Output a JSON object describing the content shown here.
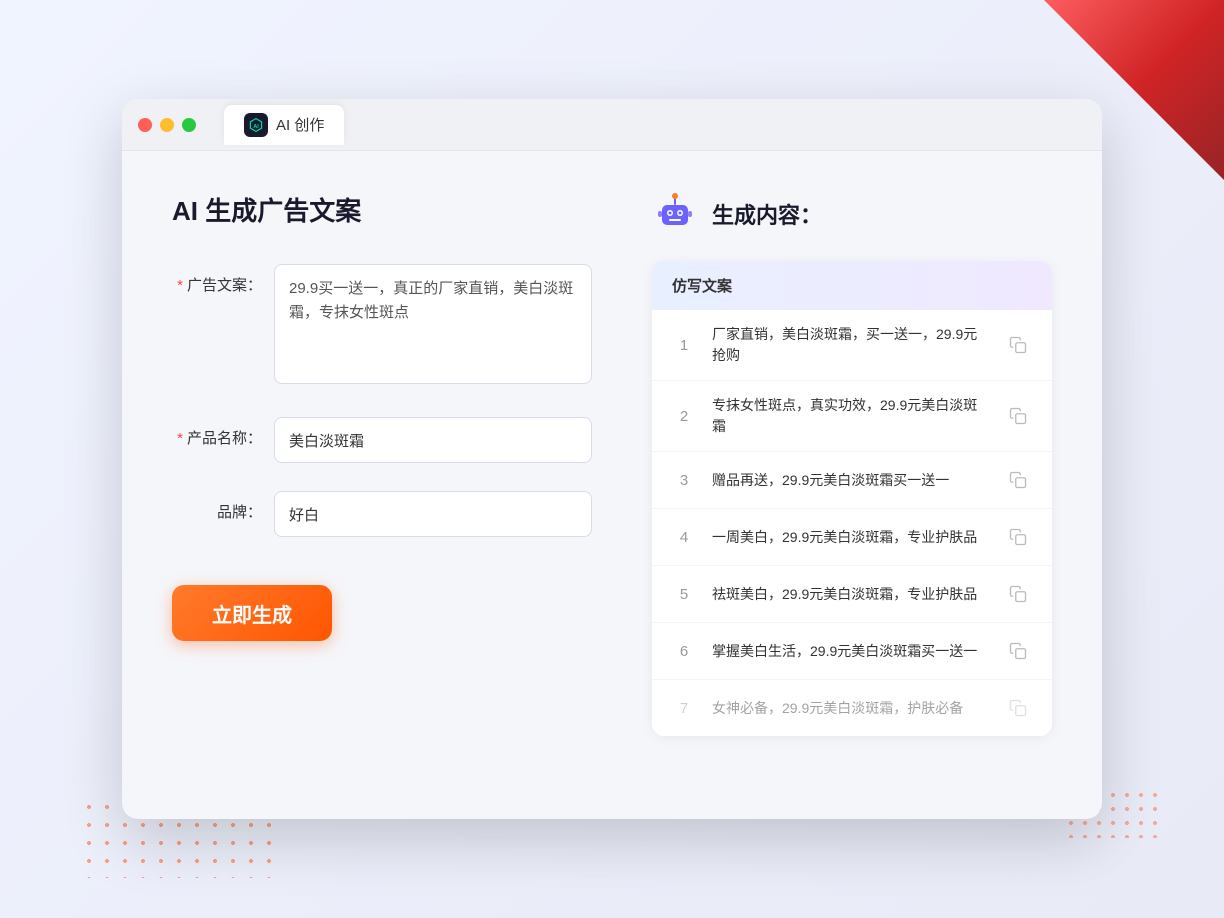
{
  "window": {
    "tab_label": "AI 创作"
  },
  "page": {
    "title": "AI 生成广告文案",
    "generate_button_label": "立即生成"
  },
  "form": {
    "ad_copy_label": "广告文案：",
    "ad_copy_required": "*",
    "ad_copy_value": "29.9买一送一，真正的厂家直销，美白淡斑霜，专抹女性斑点",
    "product_name_label": "产品名称：",
    "product_name_required": "*",
    "product_name_value": "美白淡斑霜",
    "brand_label": "品牌：",
    "brand_value": "好白"
  },
  "results": {
    "header_label": "仿写文案",
    "right_title": "生成内容：",
    "items": [
      {
        "num": "1",
        "text": "厂家直销，美白淡斑霜，买一送一，29.9元抢购",
        "dimmed": false
      },
      {
        "num": "2",
        "text": "专抹女性斑点，真实功效，29.9元美白淡斑霜",
        "dimmed": false
      },
      {
        "num": "3",
        "text": "赠品再送，29.9元美白淡斑霜买一送一",
        "dimmed": false
      },
      {
        "num": "4",
        "text": "一周美白，29.9元美白淡斑霜，专业护肤品",
        "dimmed": false
      },
      {
        "num": "5",
        "text": "祛斑美白，29.9元美白淡斑霜，专业护肤品",
        "dimmed": false
      },
      {
        "num": "6",
        "text": "掌握美白生活，29.9元美白淡斑霜买一送一",
        "dimmed": false
      },
      {
        "num": "7",
        "text": "女神必备，29.9元美白淡斑霜，护肤必备",
        "dimmed": true
      }
    ]
  },
  "traffic_lights": {
    "red_label": "close",
    "yellow_label": "minimize",
    "green_label": "maximize"
  }
}
